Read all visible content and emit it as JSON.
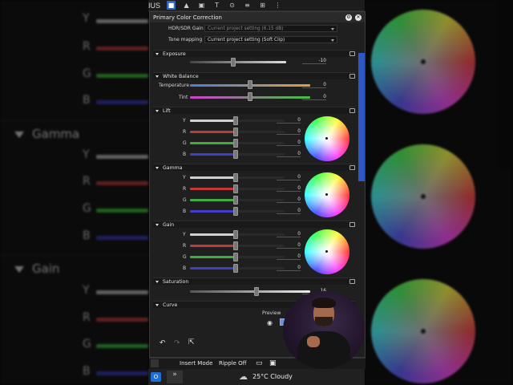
{
  "app": {
    "brand_partial": "IUS"
  },
  "panel": {
    "title": "Primary Color Correction",
    "hdr_gain_label": "HDR/SDR Gain",
    "hdr_gain_value": "Current project setting (6.15 dB)",
    "tone_mapping_label": "Tone mapping",
    "tone_mapping_value": "Current project setting (Soft Clip)"
  },
  "sections": {
    "exposure": {
      "title": "Exposure",
      "value": "-10",
      "level": 0.45
    },
    "white_balance": {
      "title": "White Balance",
      "temperature_label": "Temperature",
      "temperature_value": "0",
      "temperature_level": 0.5,
      "tint_label": "Tint",
      "tint_value": "0",
      "tint_level": 0.5
    },
    "lift": {
      "title": "Lift",
      "channels": [
        {
          "name": "Y",
          "value": "0"
        },
        {
          "name": "R",
          "value": "0"
        },
        {
          "name": "G",
          "value": "0"
        },
        {
          "name": "B",
          "value": "0"
        }
      ]
    },
    "gamma": {
      "title": "Gamma",
      "channels": [
        {
          "name": "Y",
          "value": "0"
        },
        {
          "name": "R",
          "value": "0"
        },
        {
          "name": "G",
          "value": "0"
        },
        {
          "name": "B",
          "value": "0"
        }
      ]
    },
    "gain": {
      "title": "Gain",
      "channels": [
        {
          "name": "Y",
          "value": "0"
        },
        {
          "name": "R",
          "value": "0"
        },
        {
          "name": "G",
          "value": "0"
        },
        {
          "name": "B",
          "value": "0"
        }
      ]
    },
    "saturation": {
      "title": "Saturation",
      "value": "16",
      "level": 0.55
    },
    "curve": {
      "title": "Curve",
      "preview_label": "Preview"
    }
  },
  "bottombar": {
    "insert_mode": "Insert Mode",
    "ripple": "Ripple Off"
  },
  "taskbar": {
    "weather": "25°C  Cloudy"
  },
  "background": {
    "gamma_label": "Gamma",
    "gain_label": "Gain",
    "channels": [
      "Y",
      "R",
      "G",
      "B"
    ]
  },
  "colors": {
    "accent": "#2f67c9",
    "track_y": "#d0d0d0",
    "track_r": "#c03a3a",
    "track_g": "#3fae3f",
    "track_b": "#3f3fc8",
    "temperature_from": "#4a7fd6",
    "temperature_to": "#e0a040",
    "tint_from": "#d040d0",
    "tint_to": "#40c040"
  }
}
